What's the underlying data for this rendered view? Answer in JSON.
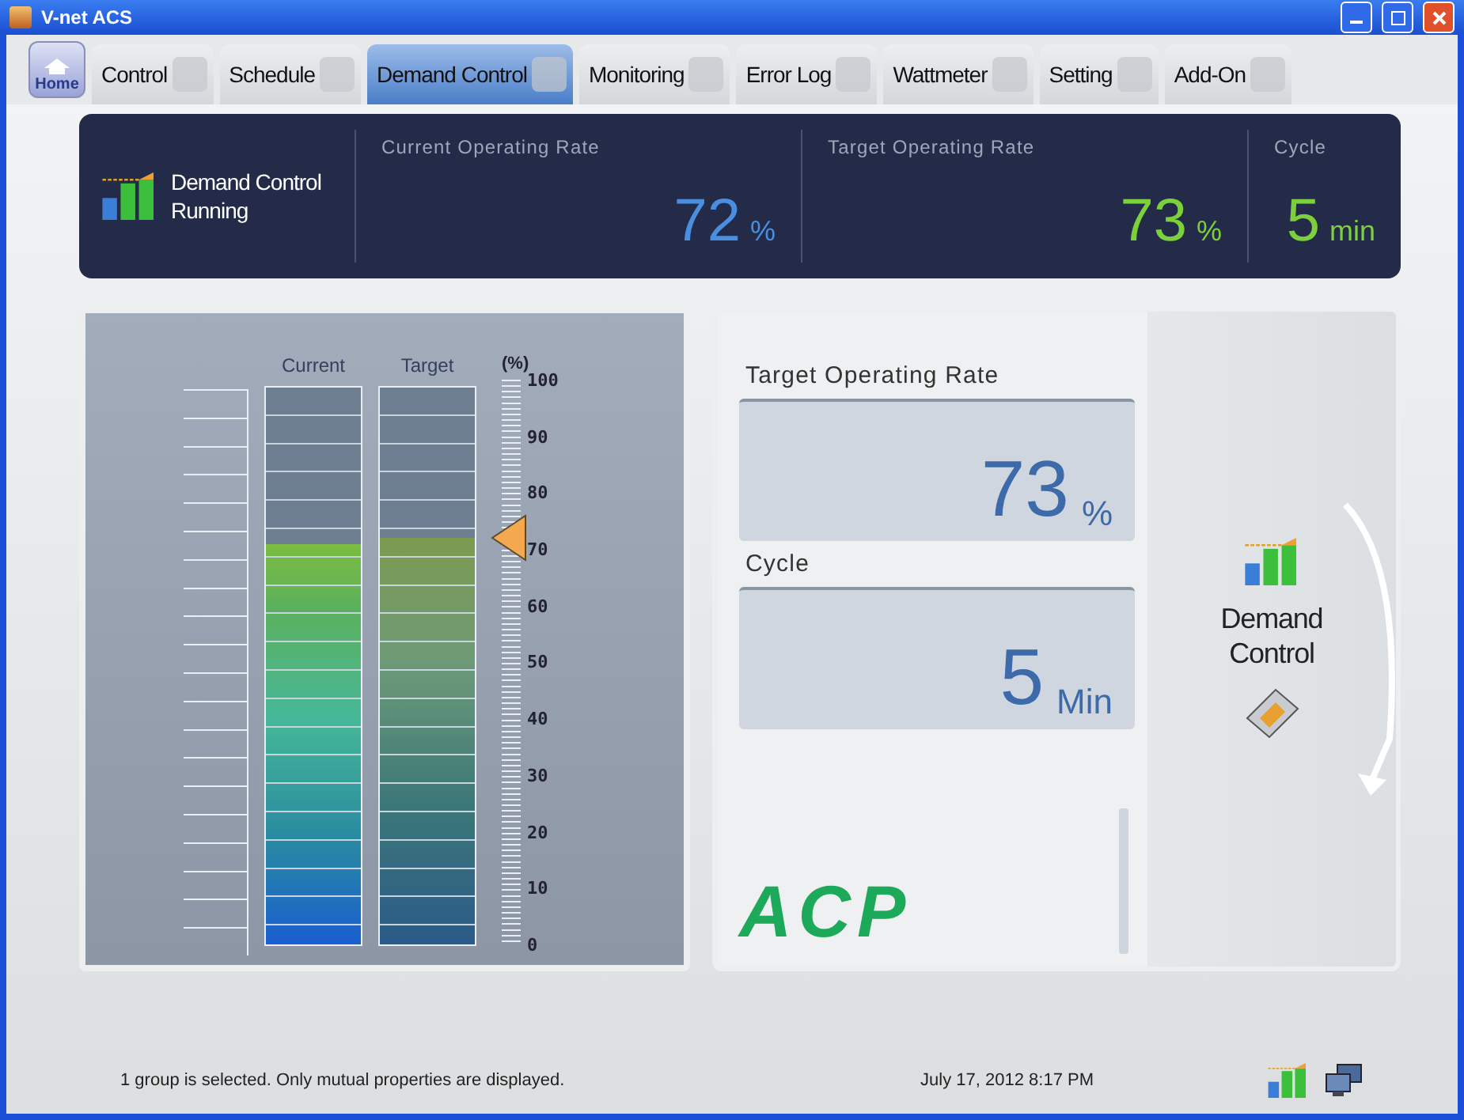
{
  "window": {
    "title": "V-net ACS"
  },
  "home": {
    "label": "Home"
  },
  "tabs": [
    {
      "label": "Control",
      "selected": false
    },
    {
      "label": "Schedule",
      "selected": false
    },
    {
      "label": "Demand Control",
      "selected": true
    },
    {
      "label": "Monitoring",
      "selected": false
    },
    {
      "label": "Error Log",
      "selected": false
    },
    {
      "label": "Wattmeter",
      "selected": false
    },
    {
      "label": "Setting",
      "selected": false
    },
    {
      "label": "Add-On",
      "selected": false
    }
  ],
  "summary": {
    "name": "Demand Control",
    "status": "Running",
    "metrics": [
      {
        "label": "Current Operating Rate",
        "value": "72",
        "unit": "%",
        "color": "#4a8ee0"
      },
      {
        "label": "Target Operating Rate",
        "value": "73",
        "unit": "%",
        "color": "#7cd03c"
      },
      {
        "label": "Cycle",
        "value": "5",
        "unit": "min",
        "color": "#7cd03c"
      }
    ]
  },
  "gauge": {
    "unit": "(%)",
    "scale_labels": [
      "100",
      "90",
      "80",
      "70",
      "60",
      "50",
      "40",
      "30",
      "20",
      "10",
      "0"
    ],
    "columns": [
      {
        "label": "Current",
        "kind": "live",
        "level": 0.72
      },
      {
        "label": "Target",
        "kind": "setpoint",
        "level": 0.73
      }
    ]
  },
  "settings": [
    {
      "label": "Target Operating Rate",
      "value": "73",
      "unit": "%"
    },
    {
      "label": "Cycle",
      "value": "5",
      "unit": "Min"
    }
  ],
  "logo": "ACP",
  "flow": {
    "label": "Demand\nControl"
  },
  "status_bar": {
    "message": "1 group is selected. Only mutual properties are displayed.",
    "datetime": "July 17, 2012  8:17 PM"
  }
}
